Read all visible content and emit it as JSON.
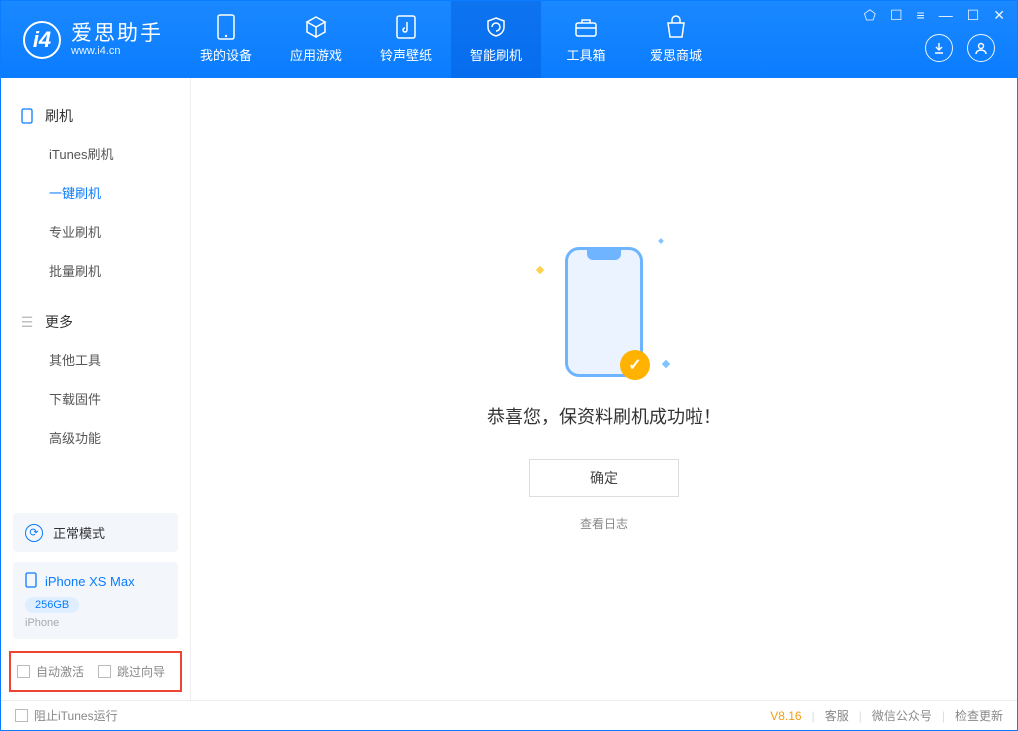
{
  "app": {
    "title": "爱思助手",
    "subtitle": "www.i4.cn"
  },
  "nav": {
    "items": [
      {
        "label": "我的设备"
      },
      {
        "label": "应用游戏"
      },
      {
        "label": "铃声壁纸"
      },
      {
        "label": "智能刷机"
      },
      {
        "label": "工具箱"
      },
      {
        "label": "爱思商城"
      }
    ]
  },
  "sidebar": {
    "group1": {
      "title": "刷机",
      "items": [
        "iTunes刷机",
        "一键刷机",
        "专业刷机",
        "批量刷机"
      ]
    },
    "group2": {
      "title": "更多",
      "items": [
        "其他工具",
        "下载固件",
        "高级功能"
      ]
    }
  },
  "device": {
    "mode": "正常模式",
    "name": "iPhone XS Max",
    "storage": "256GB",
    "type": "iPhone"
  },
  "checks": {
    "auto_activate": "自动激活",
    "skip_guide": "跳过向导"
  },
  "main": {
    "message": "恭喜您，保资料刷机成功啦！",
    "ok": "确定",
    "viewlog": "查看日志"
  },
  "footer": {
    "block_itunes": "阻止iTunes运行",
    "version": "V8.16",
    "service": "客服",
    "wechat": "微信公众号",
    "update": "检查更新"
  }
}
